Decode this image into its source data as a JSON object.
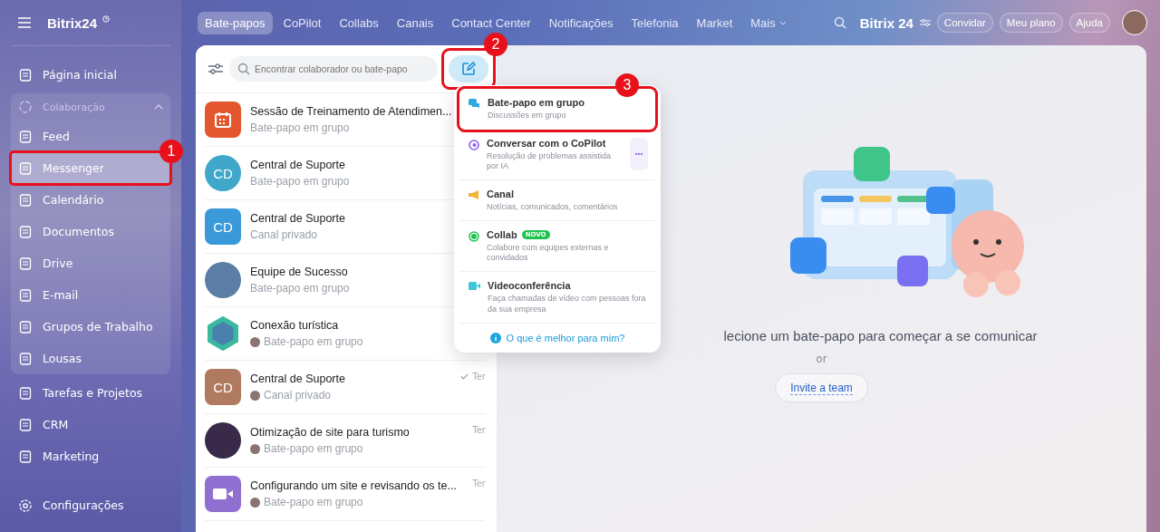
{
  "sidebar": {
    "logo": "Bitrix24",
    "items": [
      {
        "label": "Página inicial",
        "selected": false
      },
      {
        "label": "Colaboração",
        "kind": "group",
        "expanded": true,
        "children": [
          {
            "label": "Feed",
            "selected": false
          },
          {
            "label": "Messenger",
            "selected": true,
            "callout": "1"
          },
          {
            "label": "Calendário",
            "selected": false
          },
          {
            "label": "Documentos",
            "selected": false
          },
          {
            "label": "Drive",
            "selected": false
          },
          {
            "label": "E-mail",
            "selected": false
          },
          {
            "label": "Grupos de Trabalho",
            "selected": false
          },
          {
            "label": "Lousas",
            "selected": false
          }
        ]
      },
      {
        "label": "Tarefas e Projetos",
        "selected": false
      },
      {
        "label": "CRM",
        "selected": false
      },
      {
        "label": "Marketing",
        "selected": false
      }
    ],
    "settings": "Configurações"
  },
  "tabs": [
    {
      "label": "Bate-papos",
      "selected": true
    },
    {
      "label": "CoPilot",
      "selected": false
    },
    {
      "label": "Collabs",
      "selected": false
    },
    {
      "label": "Canais",
      "selected": false
    },
    {
      "label": "Contact Center",
      "selected": false
    },
    {
      "label": "Notificações",
      "selected": false
    },
    {
      "label": "Telefonia",
      "selected": false
    },
    {
      "label": "Market",
      "selected": false
    },
    {
      "label": "Mais",
      "selected": false
    }
  ],
  "header": {
    "logo": "Bitrix 24",
    "buttons": [
      "Convidar",
      "Meu plano",
      "Ajuda"
    ]
  },
  "search": {
    "placeholder": "Encontrar colaborador ou bate-papo"
  },
  "compose": {
    "callout": "2"
  },
  "chats": [
    {
      "title": "Sessão de Treinamento de Atendimen...",
      "subtitle": "Bate-papo em grupo",
      "kind": "calendar",
      "color": "#e4572e",
      "sender": false
    },
    {
      "title": "Central de Suporte",
      "subtitle": "Bate-papo em grupo",
      "kind": "initials",
      "initials": "CD",
      "color": "#3fa7c9",
      "sender": false
    },
    {
      "title": "Central de Suporte",
      "subtitle": "Canal privado",
      "kind": "tile",
      "initials": "CD",
      "color": "#3a9ad9",
      "sender": false
    },
    {
      "title": "Equipe de Sucesso",
      "subtitle": "Bate-papo em grupo",
      "kind": "photo",
      "color": "#5b7da6",
      "sender": false
    },
    {
      "title": "Conexão turística",
      "subtitle": "Bate-papo em grupo",
      "kind": "hexagon",
      "color": "#3bb8a0",
      "sender": true
    },
    {
      "title": "Central de Suporte",
      "subtitle": "Canal privado",
      "kind": "tile",
      "initials": "CD",
      "color": "#b07a60",
      "sender": true,
      "time": "Ter",
      "read": true
    },
    {
      "title": "Otimização de site para turismo",
      "subtitle": "Bate-papo em grupo",
      "kind": "photo",
      "color": "#3a2a4a",
      "sender": true,
      "time": "Ter",
      "read": false
    },
    {
      "title": "Configurando um site e revisando os te...",
      "subtitle": "Bate-papo em grupo",
      "kind": "video",
      "color": "#8f6fd0",
      "sender": true,
      "time": "Ter",
      "read": false
    }
  ],
  "menu": {
    "items": [
      {
        "title": "Bate-papo em grupo",
        "description": "Discussões em grupo",
        "kind": "chat",
        "color": "#2fa8e0",
        "callout": "3"
      },
      {
        "title": "Conversar com o CoPilot",
        "description": "Resolução de problemas assistida por IA",
        "kind": "copilot",
        "color": "#8a5cf0",
        "more": "•••"
      },
      {
        "title": "Canal",
        "description": "Notícias, comunicados, comentários",
        "kind": "channel",
        "color": "#f5b335"
      },
      {
        "title": "Collab",
        "description": "Colabore com equipes externas e convidados",
        "kind": "collab",
        "color": "#1fc34e",
        "badge": "NOVO"
      },
      {
        "title": "Videoconferência",
        "description": "Faça chamadas de vídeo com pessoas fora da sua empresa",
        "kind": "video",
        "color": "#3fc4d8"
      }
    ],
    "help": "O que é melhor para mim?"
  },
  "empty": {
    "message": "lecione um bate-papo para começar a se comunicar",
    "or": "or",
    "button": "Invite a team"
  }
}
